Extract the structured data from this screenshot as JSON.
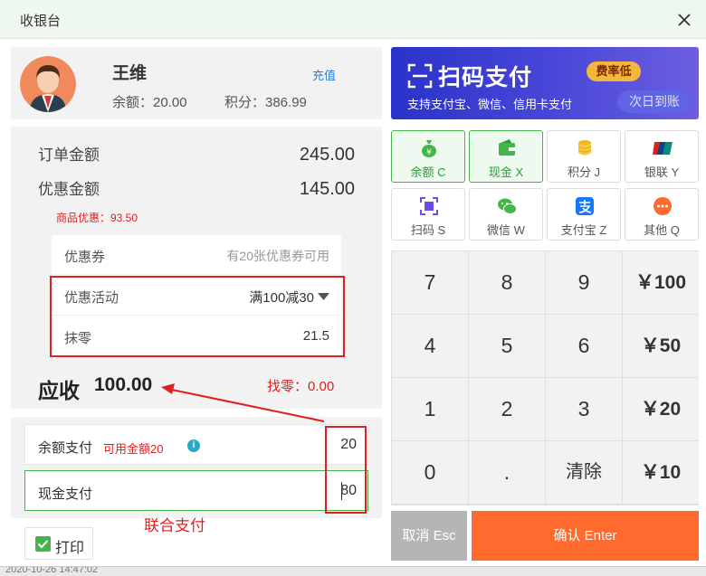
{
  "window": {
    "title": "收银台"
  },
  "member": {
    "name": "王维",
    "recharge_label": "充值",
    "balance_text": "余额：20.00",
    "points_text": "积分：386.99"
  },
  "order": {
    "order_amount_label": "订单金额",
    "order_amount": "245.00",
    "discount_amount_label": "优惠金额",
    "discount_amount": "145.00",
    "goods_discount_text": "商品优惠：93.50",
    "coupon_label": "优惠券",
    "coupon_hint": "有20张优惠券可用",
    "activity_label": "优惠活动",
    "activity_value": "满100减30",
    "rounding_label": "抹零",
    "rounding_value": "21.5",
    "due_label": "应收",
    "due_value": "100.00",
    "change_text": "找零：0.00"
  },
  "payment": {
    "balance_pay_label": "余额支付",
    "balance_available": "可用金额20",
    "balance_pay_value": "20",
    "cash_pay_label": "现金支付",
    "cash_pay_value": "80",
    "combined_note": "联合支付",
    "print_label": "打印",
    "print_checked": true
  },
  "banner": {
    "title": "扫码支付",
    "subtitle": "支持支付宝、微信、信用卡支付",
    "tag": "费率低",
    "next_day": "次日到账"
  },
  "methods": [
    {
      "label": "余额  C",
      "icon": "money-bag-icon",
      "selected": true
    },
    {
      "label": "现金  X",
      "icon": "wallet-icon",
      "selected": true
    },
    {
      "label": "积分  J",
      "icon": "coins-icon",
      "selected": false
    },
    {
      "label": "银联  Y",
      "icon": "unionpay-icon",
      "selected": false
    },
    {
      "label": "扫码  S",
      "icon": "scan-icon",
      "selected": false
    },
    {
      "label": "微信  W",
      "icon": "wechat-icon",
      "selected": false
    },
    {
      "label": "支付宝  Z",
      "icon": "alipay-icon",
      "selected": false
    },
    {
      "label": "其他  Q",
      "icon": "more-icon",
      "selected": false
    }
  ],
  "keypad": {
    "keys": [
      "7",
      "8",
      "9",
      "￥100",
      "4",
      "5",
      "6",
      "￥50",
      "1",
      "2",
      "3",
      "￥20",
      "0",
      ".",
      "清除",
      "￥10"
    ]
  },
  "actions": {
    "cancel_label": "取消 Esc",
    "confirm_label": "确认 Enter"
  },
  "footer": {
    "timestamp": "2020-10-26 14:47:02"
  },
  "colors": {
    "accent_green": "#44b549",
    "alert_red": "#e02020",
    "confirm_orange": "#ff6a2f",
    "banner_blue": "#2a33c9"
  }
}
